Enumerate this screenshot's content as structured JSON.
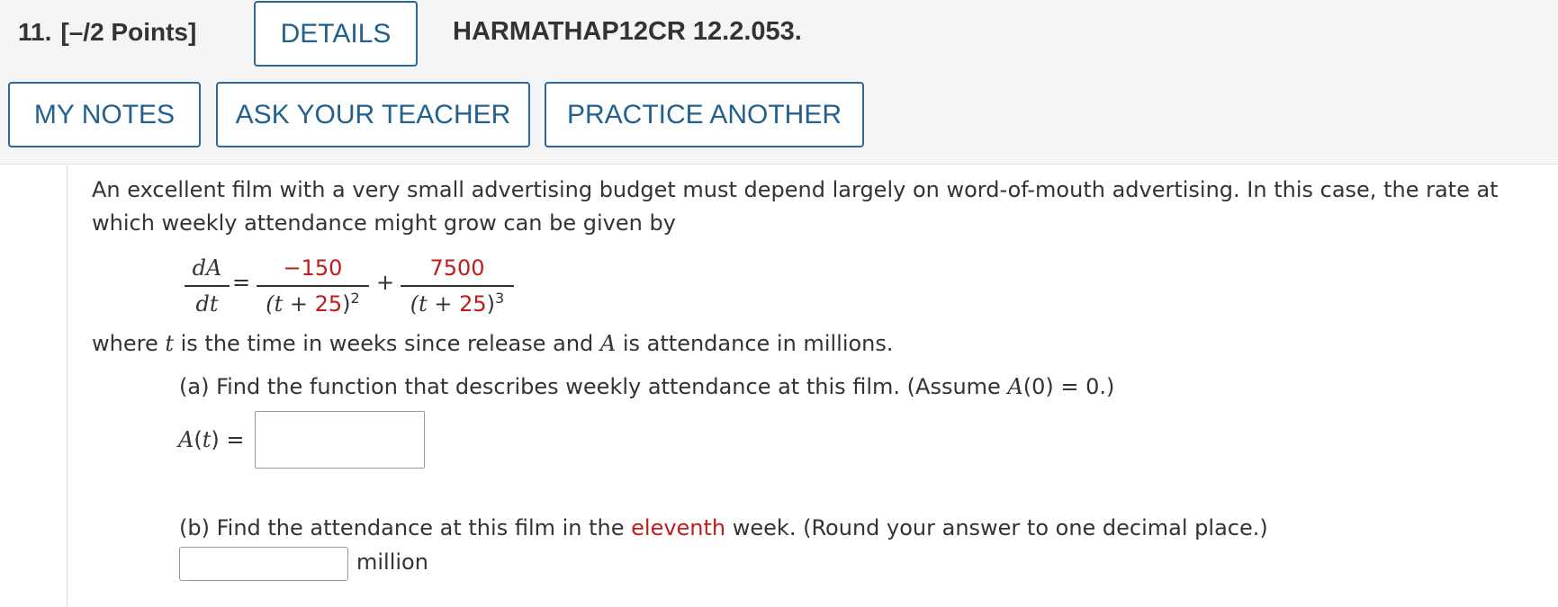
{
  "header": {
    "question_number": "11.",
    "points": "[–/2 Points]",
    "details_label": "DETAILS",
    "question_code": "HARMATHAP12CR 12.2.053.",
    "my_notes_label": "MY NOTES",
    "ask_teacher_label": "ASK YOUR TEACHER",
    "practice_another_label": "PRACTICE ANOTHER"
  },
  "problem": {
    "intro_line1": "An excellent film with a very small advertising budget must depend largely on word-of-mouth advertising. In this case, the rate at",
    "intro_line2": "which weekly attendance might grow can be given by",
    "equation": {
      "lhs_num": "dA",
      "lhs_den": "dt",
      "eq": "=",
      "term1_num": "−150",
      "term1_den_prefix": "(t + ",
      "term1_den_value": "25",
      "term1_den_suffix": ")",
      "term1_exp": "2",
      "plus": "+",
      "term2_num": "7500",
      "term2_den_prefix": "(t + ",
      "term2_den_value": "25",
      "term2_den_suffix": ")",
      "term2_exp": "3"
    },
    "where_1": "where ",
    "where_t": "t",
    "where_2": " is the time in weeks since release and ",
    "where_A": "A",
    "where_3": " is attendance in millions.",
    "part_a_1": "(a) Find the function that describes weekly attendance at this film. (Assume ",
    "part_a_A0": "A",
    "part_a_2": "(0) = 0.)",
    "part_a_label_A": "A",
    "part_a_label_t": "t",
    "part_a_label_rest": ") =",
    "part_b_1": "(b) Find the attendance at this film in the ",
    "part_b_highlight": "eleventh",
    "part_b_2": " week. (Round your answer to one decimal place.)",
    "part_b_unit": "million",
    "answer_a_value": "",
    "answer_b_value": ""
  },
  "colors": {
    "button_border": "#2e6a98",
    "button_text": "#22618f",
    "highlight_red": "#c21b1b",
    "header_bg": "#f5f5f5"
  }
}
